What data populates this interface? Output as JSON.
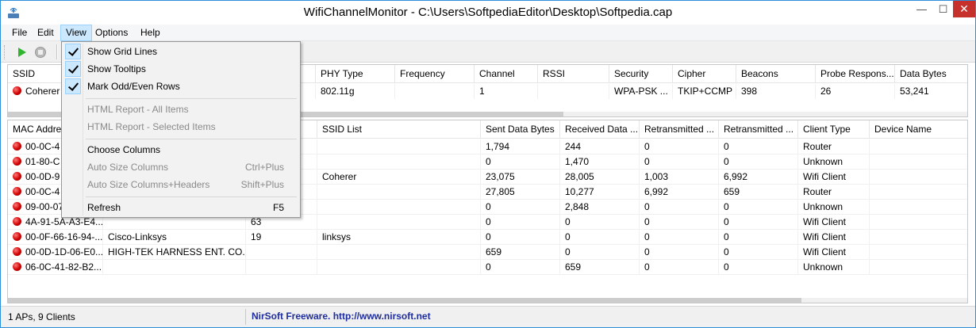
{
  "window": {
    "title": "WifiChannelMonitor  -  C:\\Users\\SoftpediaEditor\\Desktop\\Softpedia.cap",
    "min_glyph": "—",
    "max_glyph": "☐",
    "close_glyph": "✕"
  },
  "menubar": {
    "items": [
      "File",
      "Edit",
      "View",
      "Options",
      "Help"
    ],
    "active": "View"
  },
  "view_menu": {
    "show_grid_lines": "Show Grid Lines",
    "show_tooltips": "Show Tooltips",
    "mark_odd_even": "Mark Odd/Even Rows",
    "html_report_all": "HTML Report - All Items",
    "html_report_selected": "HTML Report - Selected Items",
    "choose_columns": "Choose Columns",
    "auto_size_columns": "Auto Size Columns",
    "auto_size_columns_shortcut": "Ctrl+Plus",
    "auto_size_headers": "Auto Size Columns+Headers",
    "auto_size_headers_shortcut": "Shift+Plus",
    "refresh": "Refresh",
    "refresh_shortcut": "F5"
  },
  "ap_table": {
    "headers": [
      "SSID",
      "PHY Type",
      "Frequency",
      "Channel",
      "RSSI",
      "Security",
      "Cipher",
      "Beacons",
      "Probe Respons...",
      "Data Bytes"
    ],
    "rows": [
      [
        "Coherer",
        "802.11g",
        "",
        "1",
        "",
        "WPA-PSK ...",
        "TKIP+CCMP",
        "398",
        "26",
        "53,241"
      ]
    ]
  },
  "client_table": {
    "headers": [
      "MAC Address",
      "",
      "",
      "SSID List",
      "Sent Data Bytes",
      "Received Data ...",
      "Retransmitted ...",
      "Retransmitted ...",
      "Client Type",
      "Device Name"
    ],
    "rows": [
      [
        "00-0C-4",
        "",
        "",
        "",
        "1,794",
        "244",
        "0",
        "0",
        "Router",
        ""
      ],
      [
        "01-80-C",
        "",
        "",
        "",
        "0",
        "1,470",
        "0",
        "0",
        "Unknown",
        ""
      ],
      [
        "00-0D-9",
        "",
        "",
        "Coherer",
        "23,075",
        "28,005",
        "1,003",
        "6,992",
        "Wifi Client",
        ""
      ],
      [
        "00-0C-4",
        "",
        "",
        "",
        "27,805",
        "10,277",
        "6,992",
        "659",
        "Router",
        ""
      ],
      [
        "09-00-07",
        "",
        "",
        "",
        "0",
        "2,848",
        "0",
        "0",
        "Unknown",
        ""
      ],
      [
        "4A-91-5A-A3-E4...",
        "",
        "63",
        "",
        "0",
        "0",
        "0",
        "0",
        "Wifi Client",
        ""
      ],
      [
        "00-0F-66-16-94-...",
        "Cisco-Linksys",
        "19",
        "linksys",
        "0",
        "0",
        "0",
        "0",
        "Wifi Client",
        ""
      ],
      [
        "00-0D-1D-06-E0...",
        "HIGH-TEK HARNESS ENT. CO....",
        "",
        "",
        "659",
        "0",
        "0",
        "0",
        "Wifi Client",
        ""
      ],
      [
        "06-0C-41-82-B2...",
        "",
        "",
        "",
        "0",
        "659",
        "0",
        "0",
        "Unknown",
        ""
      ]
    ]
  },
  "statusbar": {
    "summary": "1 APs, 9 Clients",
    "link": "NirSoft Freeware.  http://www.nirsoft.net"
  }
}
